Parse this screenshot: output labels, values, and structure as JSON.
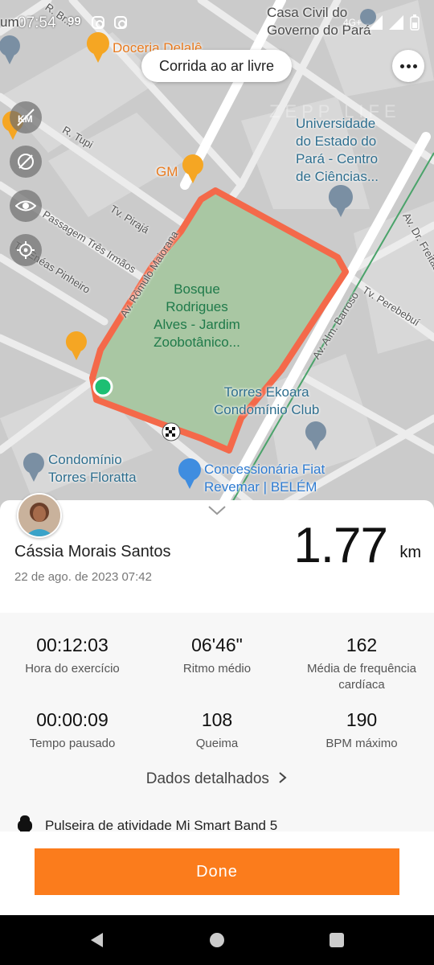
{
  "status_bar": {
    "time": "07:54",
    "network": "99",
    "signal": "4G+"
  },
  "map": {
    "activity_type": "Corrida ao ar livre",
    "watermark": "ZEPP LIFE",
    "labels": {
      "casa_civil": "Casa Civil do\nGoverno do Pará",
      "doceria": "Doceria Delalê",
      "ufpa": "Universidade\ndo Estado do\nPará - Centro\nde Ciências...",
      "gm": "GM",
      "r_tupi": "R. Tupi",
      "tv_piraja": "Tv. Pirajá",
      "passagem": "Passagem Três Irmãos",
      "tv_eneas": "Tv. Enéas Pinheiro",
      "av_romulo": "Av. Rômulo Maiorana",
      "bosque": "Bosque\nRodrigues\nAlves - Jardim\nZoobotânico...",
      "av_almirante": "Av. Alm. Barroso",
      "tv_perebebui": "Tv. Perebebuí",
      "av_freitas": "Av. Dr. Freitas",
      "torres_ekoara": "Torres Ekoara\nCondomínio Club",
      "cond_floratta": "Condomínio\nTorres Floratta",
      "fiat": "Concessionária Fiat\nRevemar | BELÉM",
      "r_brasil": "R. Br...",
      "um": "um"
    }
  },
  "user": {
    "name": "Cássia Morais Santos",
    "date": "22 de ago. de 2023 07:42"
  },
  "distance": {
    "value": "1.77",
    "unit": "km"
  },
  "stats": [
    {
      "value": "00:12:03",
      "label": "Hora do exercício"
    },
    {
      "value": "06'46\"",
      "label": "Ritmo médio"
    },
    {
      "value": "162",
      "label": "Média de frequência\ncardíaca"
    },
    {
      "value": "00:00:09",
      "label": "Tempo pausado"
    },
    {
      "value": "108",
      "label": "Queima"
    },
    {
      "value": "190",
      "label": "BPM máximo"
    }
  ],
  "details_link": "Dados detalhados",
  "device": "Pulseira de atividade Mi Smart Band 5",
  "done_button": "Done",
  "colors": {
    "accent": "#fb7c1c",
    "route": "#f4694a",
    "park": "#a9c7a3"
  }
}
